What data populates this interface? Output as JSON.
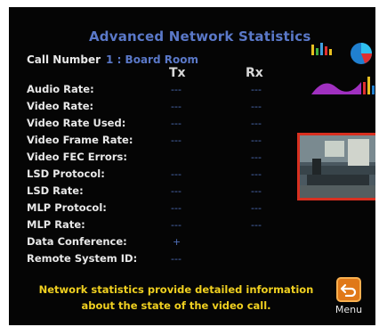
{
  "title": "Advanced Network Statistics",
  "call": {
    "label": "Call Number",
    "value": "1 : Board Room"
  },
  "columns": {
    "tx": "Tx",
    "rx": "Rx"
  },
  "rows": [
    {
      "label": "Audio Rate:",
      "tx": "---",
      "rx": "---"
    },
    {
      "label": "Video Rate:",
      "tx": "---",
      "rx": "---"
    },
    {
      "label": "Video Rate Used:",
      "tx": "---",
      "rx": "---"
    },
    {
      "label": "Video Frame Rate:",
      "tx": "---",
      "rx": "---"
    },
    {
      "label": "Video FEC Errors:",
      "tx": "",
      "rx": "---"
    },
    {
      "label": "LSD Protocol:",
      "tx": "---",
      "rx": "---"
    },
    {
      "label": "LSD Rate:",
      "tx": "---",
      "rx": "---"
    },
    {
      "label": "MLP Protocol:",
      "tx": "---",
      "rx": "---"
    },
    {
      "label": "MLP Rate:",
      "tx": "---",
      "rx": "---"
    },
    {
      "label": "Data Conference:",
      "tx": "+",
      "rx": ""
    },
    {
      "label": "Remote System ID:",
      "tx": "---",
      "rx": ""
    }
  ],
  "info": "Network statistics provide detailed information about the state of the video call.",
  "menu": {
    "label": "Menu",
    "icon": "return-arrow-icon"
  },
  "colors": {
    "background": "#050505",
    "title": "#5a78c8",
    "label": "#e8e8e8",
    "value": "#4f6fb8",
    "info": "#f0d020",
    "accent": "#e07818"
  }
}
